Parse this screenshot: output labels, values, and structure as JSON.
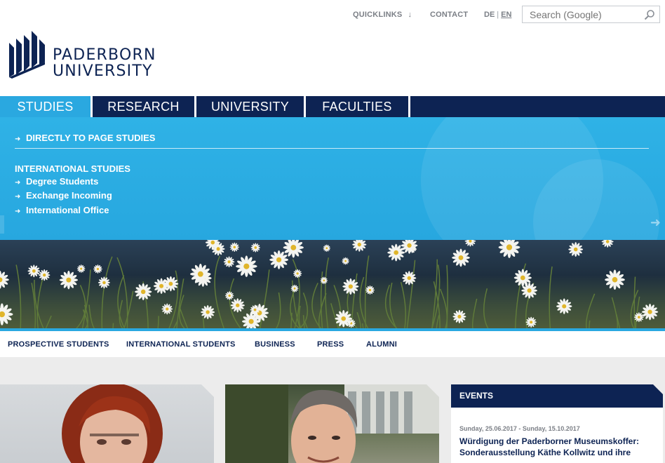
{
  "utility": {
    "quicklinks": "QUICKLINKS",
    "contact": "CONTACT",
    "lang_de": "DE",
    "lang_sep": "|",
    "lang_en": "EN",
    "search_placeholder": "Search (Google)"
  },
  "logo": {
    "line1": "PADERBORN",
    "line2": "UNIVERSITY"
  },
  "main_nav": {
    "tabs": [
      {
        "label": "STUDIES",
        "active": true
      },
      {
        "label": "RESEARCH",
        "active": false
      },
      {
        "label": "UNIVERSITY",
        "active": false
      },
      {
        "label": "FACULTIES",
        "active": false
      }
    ]
  },
  "flyout": {
    "direct_link": "DIRECTLY TO PAGE STUDIES",
    "heading": "INTERNATIONAL STUDIES",
    "items": [
      "Degree Students",
      "Exchange Incoming",
      "International Office"
    ]
  },
  "sub_nav": {
    "items": [
      "PROSPECTIVE STUDENTS",
      "INTERNATIONAL STUDENTS",
      "BUSINESS",
      "PRESS",
      "ALUMNI"
    ]
  },
  "events": {
    "title": "EVENTS",
    "date": "Sunday, 25.06.2017 - Sunday, 15.10.2017",
    "headline": "Würdigung der Paderborner Museumskoffer: Sonderausstellung Käthe Kollwitz und ihre"
  },
  "colors": {
    "navy": "#0d2353",
    "accent_blue": "#2aa8e0",
    "gray_text": "#7b7f86",
    "background_gray": "#ececec"
  },
  "icons": {
    "search": "magnifier-icon",
    "dropdown": "arrow-down-icon",
    "bullet": "arrow-right-icon"
  }
}
